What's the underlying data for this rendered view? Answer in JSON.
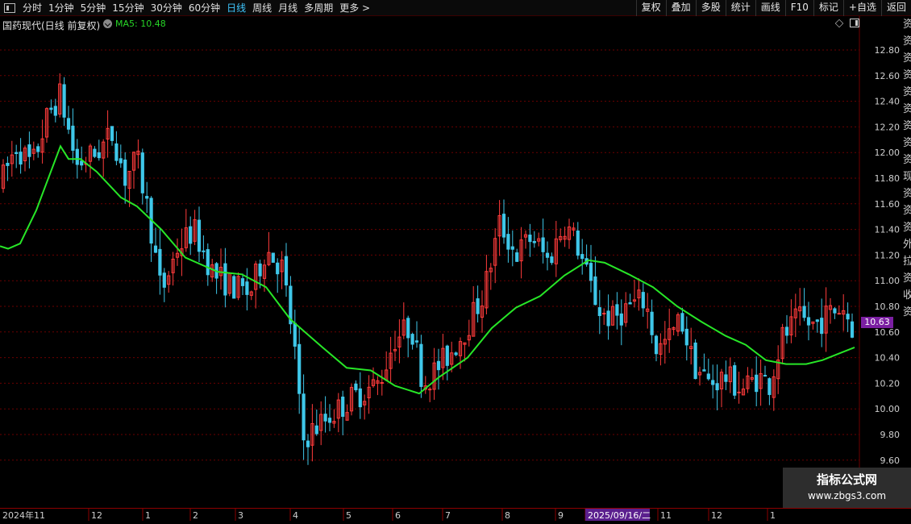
{
  "toolbar": {
    "periods": [
      "分时",
      "1分钟",
      "5分钟",
      "15分钟",
      "30分钟",
      "60分钟",
      "日线",
      "周线",
      "月线",
      "多周期",
      "更多 >"
    ],
    "active_period": "日线",
    "buttons": [
      "复权",
      "叠加",
      "多股",
      "统计",
      "画线",
      "F10",
      "标记",
      "+自选",
      "返回"
    ]
  },
  "stock_title": "国药现代(日线 前复权)",
  "ma_legend": "MA5: 10.48",
  "side_strip_text": "资资资资资资资资资现资资资外拉资收资",
  "current_price_label": "10.63",
  "watermark": {
    "line1": "指标公式网",
    "line2": "www.zbgs3.com"
  },
  "colors": {
    "up": "#ff3b3b",
    "down": "#3fc7e9",
    "ma": "#27e627",
    "grid": "#6b0000",
    "axis_text": "#cfcfcf",
    "selected_date_bg": "#5b1f8e",
    "price_tag_bg": "#7b1fa2"
  },
  "chart_data": {
    "type": "candlestick",
    "title": "国药现代(日线 前复权)",
    "y_axis_ticks": [
      "12.80",
      "12.60",
      "12.40",
      "12.20",
      "12.00",
      "11.80",
      "11.60",
      "11.40",
      "11.20",
      "11.00",
      "10.80",
      "10.60",
      "10.40",
      "10.20",
      "10.00",
      "9.80",
      "9.60"
    ],
    "ylim": [
      9.45,
      13.05
    ],
    "x_axis_labels": [
      "2024年11",
      "12",
      "1",
      "2",
      "3",
      "4",
      "5",
      "6",
      "7",
      "8",
      "9",
      "2025/09/16/二",
      "11",
      "12",
      "1"
    ],
    "selected_date": "2025/09/16/二",
    "ma_series": {
      "name": "MA5",
      "last_value": 10.48,
      "anchors": [
        [
          0,
          11.27
        ],
        [
          10,
          11.25
        ],
        [
          25,
          11.29
        ],
        [
          45,
          11.55
        ],
        [
          60,
          11.8
        ],
        [
          75,
          12.05
        ],
        [
          85,
          11.95
        ],
        [
          100,
          11.95
        ],
        [
          120,
          11.85
        ],
        [
          150,
          11.65
        ],
        [
          170,
          11.58
        ],
        [
          200,
          11.4
        ],
        [
          230,
          11.18
        ],
        [
          270,
          11.07
        ],
        [
          300,
          11.05
        ],
        [
          330,
          10.95
        ],
        [
          360,
          10.7
        ],
        [
          400,
          10.48
        ],
        [
          430,
          10.32
        ],
        [
          460,
          10.3
        ],
        [
          490,
          10.18
        ],
        [
          520,
          10.12
        ],
        [
          545,
          10.25
        ],
        [
          580,
          10.4
        ],
        [
          610,
          10.63
        ],
        [
          640,
          10.79
        ],
        [
          670,
          10.88
        ],
        [
          700,
          11.04
        ],
        [
          730,
          11.16
        ],
        [
          750,
          11.14
        ],
        [
          780,
          11.05
        ],
        [
          810,
          10.95
        ],
        [
          840,
          10.8
        ],
        [
          870,
          10.68
        ],
        [
          900,
          10.57
        ],
        [
          925,
          10.5
        ],
        [
          950,
          10.38
        ],
        [
          975,
          10.35
        ],
        [
          1000,
          10.35
        ],
        [
          1020,
          10.38
        ],
        [
          1040,
          10.43
        ],
        [
          1060,
          10.48
        ]
      ]
    },
    "price_path": [
      [
        0,
        11.75
      ],
      [
        20,
        12.05
      ],
      [
        40,
        11.9
      ],
      [
        60,
        12.3
      ],
      [
        75,
        12.45
      ],
      [
        95,
        11.9
      ],
      [
        120,
        12.0
      ],
      [
        140,
        12.15
      ],
      [
        155,
        11.8
      ],
      [
        170,
        11.95
      ],
      [
        185,
        11.5
      ],
      [
        200,
        10.9
      ],
      [
        220,
        11.25
      ],
      [
        240,
        11.4
      ],
      [
        265,
        11.05
      ],
      [
        290,
        10.95
      ],
      [
        310,
        10.9
      ],
      [
        330,
        11.25
      ],
      [
        350,
        11.1
      ],
      [
        365,
        10.5
      ],
      [
        375,
        9.75
      ],
      [
        390,
        9.85
      ],
      [
        410,
        9.95
      ],
      [
        440,
        10.1
      ],
      [
        470,
        10.2
      ],
      [
        490,
        10.55
      ],
      [
        510,
        10.65
      ],
      [
        525,
        10.2
      ],
      [
        540,
        10.3
      ],
      [
        560,
        10.45
      ],
      [
        580,
        10.65
      ],
      [
        600,
        10.9
      ],
      [
        620,
        11.45
      ],
      [
        640,
        11.2
      ],
      [
        660,
        11.35
      ],
      [
        680,
        11.15
      ],
      [
        700,
        11.45
      ],
      [
        715,
        11.3
      ],
      [
        730,
        11.0
      ],
      [
        745,
        10.75
      ],
      [
        760,
        10.7
      ],
      [
        780,
        10.8
      ],
      [
        800,
        10.85
      ],
      [
        815,
        10.45
      ],
      [
        830,
        10.55
      ],
      [
        845,
        10.7
      ],
      [
        860,
        10.35
      ],
      [
        880,
        10.2
      ],
      [
        900,
        10.25
      ],
      [
        920,
        10.15
      ],
      [
        940,
        10.25
      ],
      [
        955,
        10.2
      ],
      [
        970,
        10.55
      ],
      [
        990,
        10.7
      ],
      [
        1010,
        10.65
      ],
      [
        1030,
        10.75
      ],
      [
        1045,
        10.8
      ],
      [
        1058,
        10.63
      ]
    ],
    "last_close": 10.63,
    "grid": true
  }
}
